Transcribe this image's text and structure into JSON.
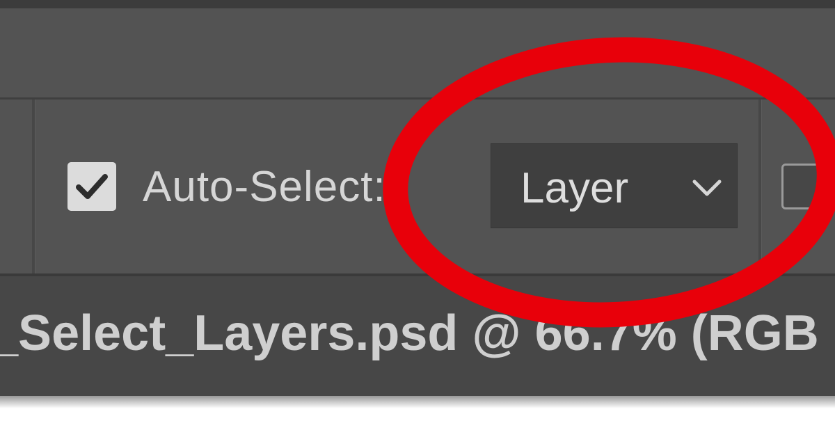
{
  "options_bar": {
    "auto_select_label": "Auto-Select:",
    "auto_select_checked": true,
    "auto_select_mode": "Layer"
  },
  "document": {
    "tab_title": "_Select_Layers.psd @ 66.7% (RGB"
  },
  "icons": {
    "checkbox": "checkmark-icon",
    "dropdown": "chevron-down-icon"
  },
  "colors": {
    "panel": "#535353",
    "panel_dark": "#3f3f3f",
    "text": "#d6d6d6",
    "annotation": "#e8000a"
  }
}
